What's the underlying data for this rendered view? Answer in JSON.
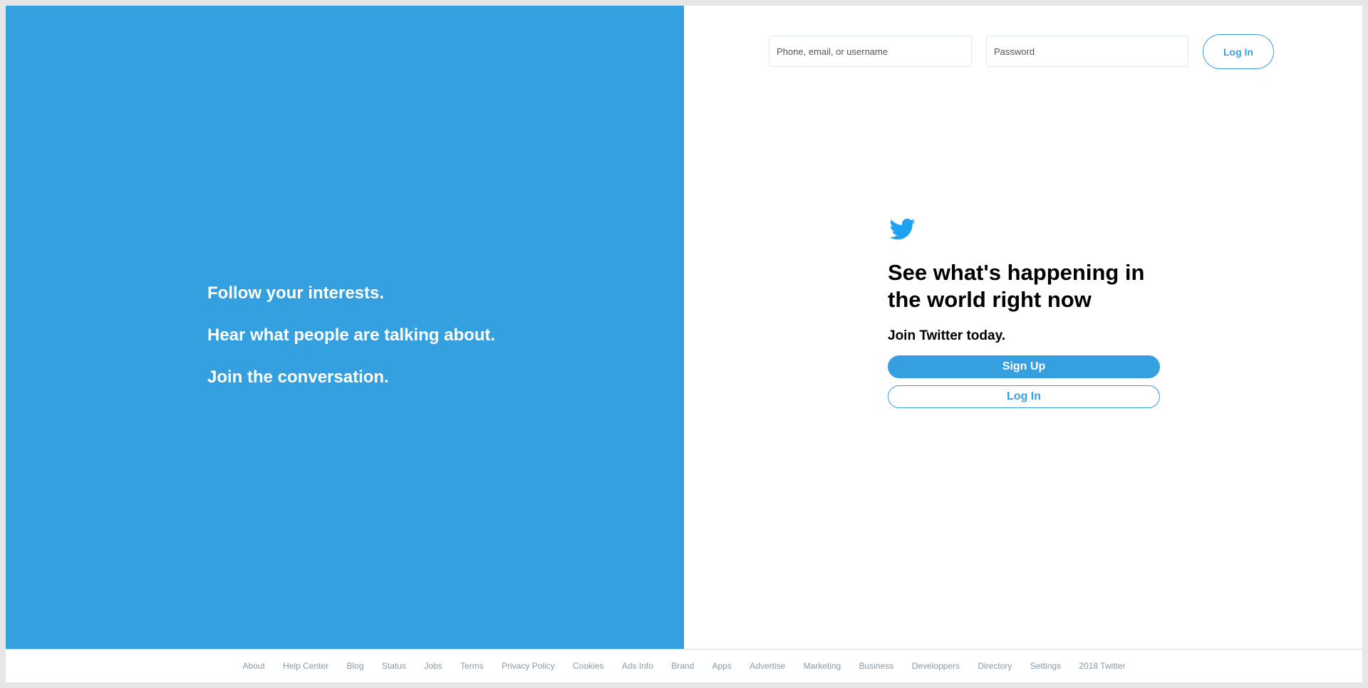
{
  "left": {
    "lines": [
      "Follow your interests.",
      "Hear what people are talking about.",
      "Join the conversation."
    ]
  },
  "login_bar": {
    "username_placeholder": "Phone, email, or username",
    "password_placeholder": "Password",
    "login_label": "Log In"
  },
  "join": {
    "logo_icon": "twitter-bird-icon",
    "headline": "See what's happening in the world right now",
    "subhead": "Join Twitter today.",
    "signup_label": "Sign Up",
    "login_label": "Log In"
  },
  "footer": {
    "links": [
      "About",
      "Help Center",
      "Blog",
      "Status",
      "Jobs",
      "Terms",
      "Privacy Policy",
      "Cookies",
      "Ads Info",
      "Brand",
      "Apps",
      "Advertise",
      "Marketing",
      "Business",
      "Developpers",
      "Directory",
      "Settings",
      "2018 Twitter"
    ]
  },
  "colors": {
    "brand_blue": "#34a0e0",
    "twitter_blue": "#1da1f2",
    "footer_link": "#8899a6"
  }
}
